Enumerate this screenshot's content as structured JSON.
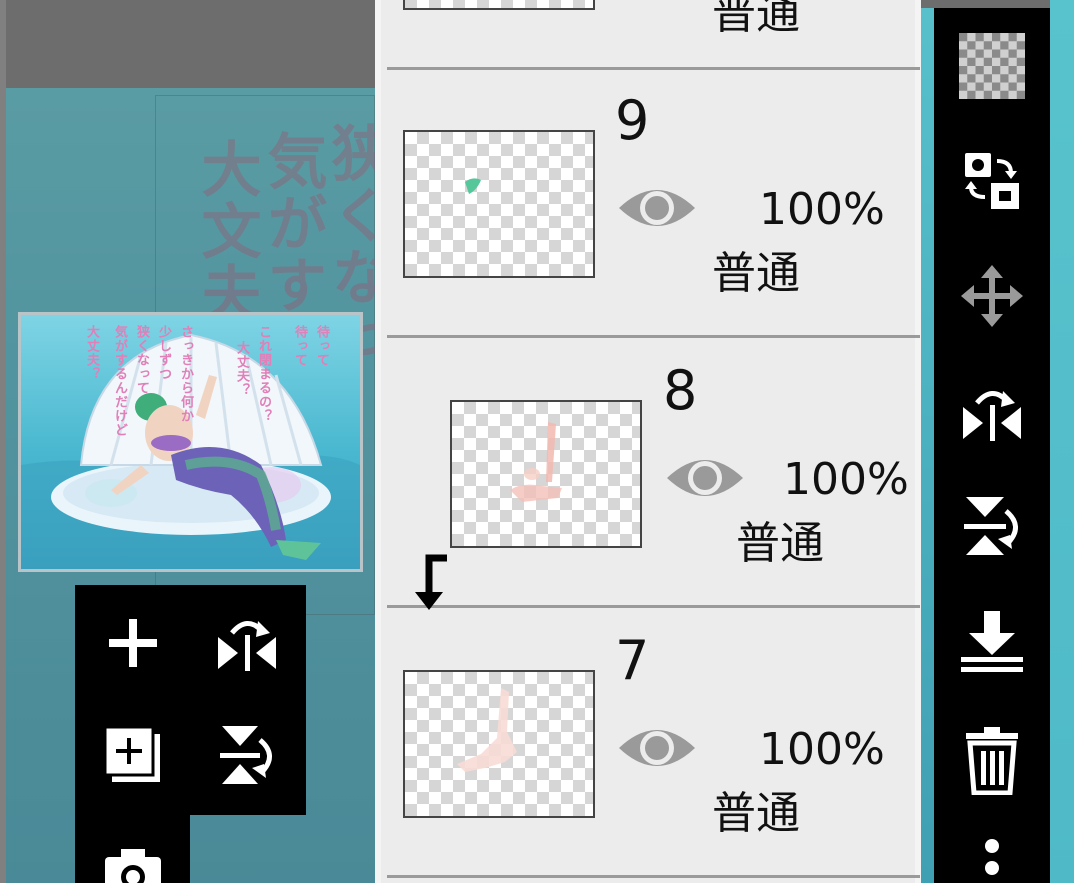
{
  "app": {
    "accent_black": "#000000",
    "panel_bg": "#ececec",
    "checker_gray": "#d6d6d6"
  },
  "background": {
    "columns": [
      "狭くなっ",
      "気がする",
      "大文夫？"
    ]
  },
  "thumbnail": {
    "columns": [
      "待って",
      "待って",
      "これ閉まるの？",
      "大丈夫？",
      "さっきから何か",
      "少しずつ",
      "狭くなって",
      "気がするんだけど",
      "大丈夫？"
    ]
  },
  "float_toolbar": {
    "buttons": [
      {
        "id": "add-layer",
        "icon": "plus-icon"
      },
      {
        "id": "flip-horizontal",
        "icon": "flip-horizontal-icon"
      },
      {
        "id": "add-layer-copy",
        "icon": "copy-plus-icon"
      },
      {
        "id": "flip-vertical",
        "icon": "flip-vertical-icon"
      },
      {
        "id": "camera",
        "icon": "camera-icon"
      }
    ]
  },
  "layers": [
    {
      "number": "",
      "opacity": "",
      "blend": "普通",
      "visible": true,
      "clipped": false
    },
    {
      "number": "9",
      "opacity": "100%",
      "blend": "普通",
      "visible": true,
      "clipped": false
    },
    {
      "number": "8",
      "opacity": "100%",
      "blend": "普通",
      "visible": true,
      "clipped": true
    },
    {
      "number": "7",
      "opacity": "100%",
      "blend": "普通",
      "visible": true,
      "clipped": false
    }
  ],
  "right_toolbar": {
    "buttons": [
      {
        "id": "transparency",
        "icon": "checkerboard-icon"
      },
      {
        "id": "swap-layers",
        "icon": "swap-icon"
      },
      {
        "id": "move-layer",
        "icon": "move-arrows-icon"
      },
      {
        "id": "flip-layer-horizontal",
        "icon": "flip-horizontal-icon"
      },
      {
        "id": "flip-layer-vertical",
        "icon": "flip-vertical-icon"
      },
      {
        "id": "merge-down",
        "icon": "merge-down-icon"
      },
      {
        "id": "delete-layer",
        "icon": "trash-icon"
      },
      {
        "id": "more-options",
        "icon": "more-vertical-icon"
      }
    ]
  }
}
